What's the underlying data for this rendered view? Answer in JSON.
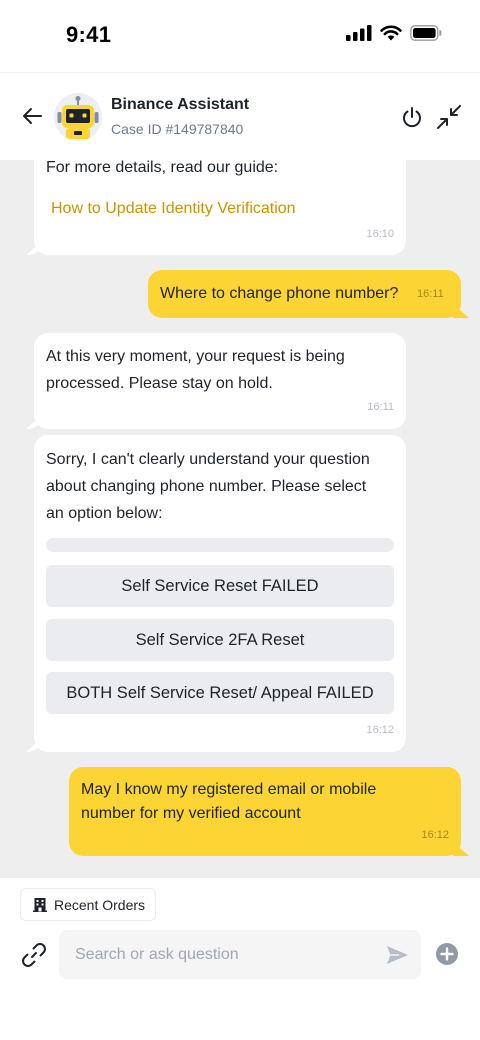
{
  "status_bar": {
    "time": "9:41"
  },
  "header": {
    "title": "Binance Assistant",
    "case_id": "Case ID #149787840"
  },
  "messages": {
    "m1": {
      "text": "For more details, read our guide:",
      "link": "How to Update Identity Verification",
      "time": "16:10"
    },
    "m2": {
      "text": "Where to change phone number?",
      "time": "16:11"
    },
    "m3": {
      "line1": "At this very moment, your request is being",
      "line2": "processed. Please stay on hold.",
      "time": "16:11"
    },
    "m4": {
      "line1": "Sorry, I can't clearly understand your question",
      "line2": "about changing phone number. Please select",
      "line3": "an option below:",
      "options": [
        "Self Service Reset FAILED",
        "Self Service 2FA Reset",
        "BOTH Self Service Reset/ Appeal FAILED"
      ],
      "time": "16:12"
    },
    "m5": {
      "line1": "May I know my registered email or mobile",
      "line2": "number for my verified account",
      "time": "16:12"
    }
  },
  "footer": {
    "recent_orders_label": "Recent Orders",
    "search_placeholder": "Search or ask question"
  },
  "colors": {
    "brand_yellow": "#fcd535",
    "link_gold": "#c99400",
    "chat_background": "#eeeeee"
  }
}
